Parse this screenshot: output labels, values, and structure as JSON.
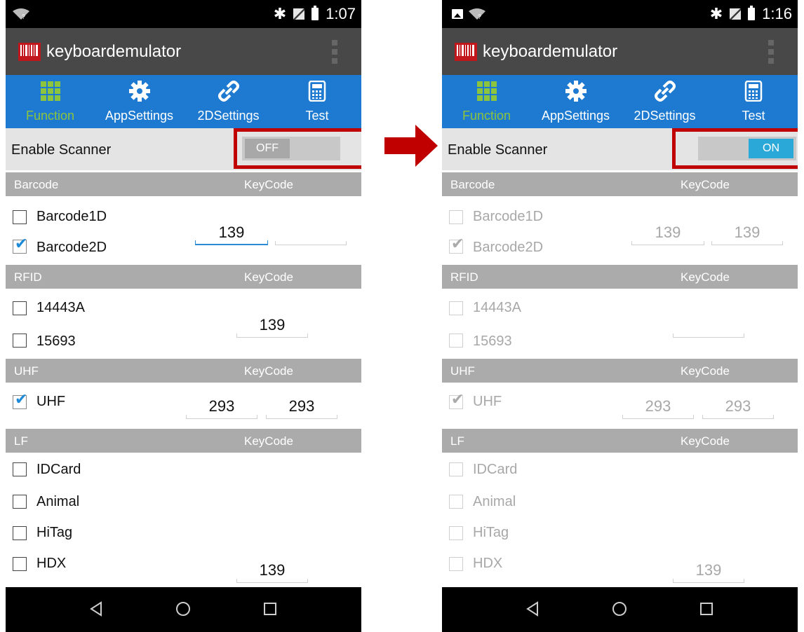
{
  "left": {
    "status": {
      "time": "1:07",
      "show_image_icon": false
    },
    "app_title": "keyboardemulator",
    "tabs": [
      {
        "label": "Function",
        "icon": "grid-icon",
        "active": true
      },
      {
        "label": "AppSettings",
        "icon": "gear-icon",
        "active": false
      },
      {
        "label": "2DSettings",
        "icon": "link-icon",
        "active": false
      },
      {
        "label": "Test",
        "icon": "calculator-icon",
        "active": false
      }
    ],
    "enable_scanner": {
      "label": "Enable Scanner",
      "state": "OFF"
    },
    "barcode": {
      "title": "Barcode",
      "keycode": "KeyCode",
      "items": [
        {
          "label": "Barcode1D",
          "checked": false
        },
        {
          "label": "Barcode2D",
          "checked": true
        }
      ],
      "field1": "139",
      "field2": ""
    },
    "rfid": {
      "title": "RFID",
      "keycode": "KeyCode",
      "items": [
        {
          "label": "14443A",
          "checked": false
        },
        {
          "label": "15693",
          "checked": false
        }
      ],
      "field": "139"
    },
    "uhf": {
      "title": "UHF",
      "keycode": "KeyCode",
      "items": [
        {
          "label": "UHF",
          "checked": true
        }
      ],
      "field1": "293",
      "field2": "293"
    },
    "lf": {
      "title": "LF",
      "keycode": "KeyCode",
      "items": [
        {
          "label": "IDCard",
          "checked": false
        },
        {
          "label": "Animal",
          "checked": false
        },
        {
          "label": "HiTag",
          "checked": false
        },
        {
          "label": "HDX",
          "checked": false
        }
      ],
      "field": "139"
    }
  },
  "right": {
    "status": {
      "time": "1:16",
      "show_image_icon": true
    },
    "app_title": "keyboardemulator",
    "tabs": [
      {
        "label": "Function",
        "icon": "grid-icon",
        "active": true
      },
      {
        "label": "AppSettings",
        "icon": "gear-icon",
        "active": false
      },
      {
        "label": "2DSettings",
        "icon": "link-icon",
        "active": false
      },
      {
        "label": "Test",
        "icon": "calculator-icon",
        "active": false
      }
    ],
    "enable_scanner": {
      "label": "Enable Scanner",
      "state": "ON"
    },
    "barcode": {
      "title": "Barcode",
      "keycode": "KeyCode",
      "items": [
        {
          "label": "Barcode1D",
          "checked": false
        },
        {
          "label": "Barcode2D",
          "checked": true
        }
      ],
      "field1": "139",
      "field2": "139"
    },
    "rfid": {
      "title": "RFID",
      "keycode": "KeyCode",
      "items": [
        {
          "label": "14443A",
          "checked": false
        },
        {
          "label": "15693",
          "checked": false
        }
      ],
      "field": ""
    },
    "uhf": {
      "title": "UHF",
      "keycode": "KeyCode",
      "items": [
        {
          "label": "UHF",
          "checked": true
        }
      ],
      "field1": "293",
      "field2": "293"
    },
    "lf": {
      "title": "LF",
      "keycode": "KeyCode",
      "items": [
        {
          "label": "IDCard",
          "checked": false
        },
        {
          "label": "Animal",
          "checked": false
        },
        {
          "label": "HiTag",
          "checked": false
        },
        {
          "label": "HDX",
          "checked": false
        }
      ],
      "field": "139"
    }
  },
  "colors": {
    "accent_blue": "#1d7ad0",
    "active_tab_green": "#8cc43d",
    "highlight_red": "#c00000",
    "toggle_on": "#2aa8d8"
  }
}
